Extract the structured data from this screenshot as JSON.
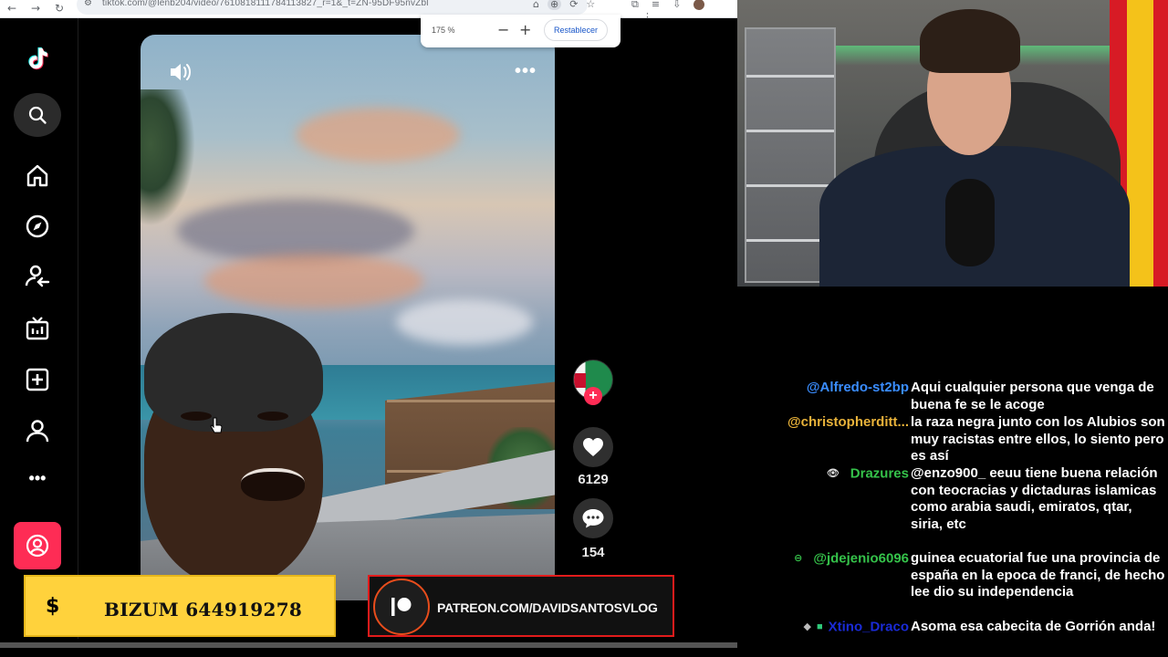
{
  "browser": {
    "url": "tiktok.com/@lenb204/video/7610818111784113827_r=1&_t=ZN-95DF95nvZbl",
    "zoom_level": "175 %",
    "zoom_minus": "−",
    "zoom_plus": "+",
    "zoom_reset": "Restablecer"
  },
  "tiktok": {
    "sidebar_icons": [
      "tiktok-logo",
      "search",
      "home",
      "explore",
      "following",
      "live",
      "upload",
      "profile",
      "more",
      "login"
    ],
    "more_label": "•••",
    "video_more": "•••",
    "likes": "6129",
    "comments": "154",
    "follow_plus": "+"
  },
  "banners": {
    "bizum_symbol": "$",
    "bizum_text": "BIZUM 644919278",
    "patreon_text": "PATREON.COM/DAVIDSANTOSVLOG"
  },
  "chat": {
    "messages": [
      {
        "user": "@Alfredo-st2bp",
        "color": "#3a8dff",
        "text": "Aqui cualquier persona que venga de buena fe se le acoge"
      },
      {
        "user": "@christopherditt...",
        "color": "#e8b23a",
        "text": "la raza negra junto con los Alubios son muy racistas entre ellos, lo siento pero es así"
      },
      {
        "user": "Drazures",
        "color": "#35c24a",
        "badge": "eye",
        "text": "@enzo900_ eeuu tiene buena relación con teocracias y dictaduras islamicas como arabia saudi, emiratos, qtar, siria, etc"
      },
      {
        "user": "@jdejenio6096",
        "color": "#35c24a",
        "badge": "link",
        "text": "guinea ecuatorial fue una provincia de españa en la epoca de franci, de hecho lee dio su independencia"
      },
      {
        "user": "Xtino_Draco",
        "color": "#1a2bd6",
        "badge": "gems",
        "text": "Asoma esa cabecita de Gorrión anda!"
      }
    ]
  }
}
